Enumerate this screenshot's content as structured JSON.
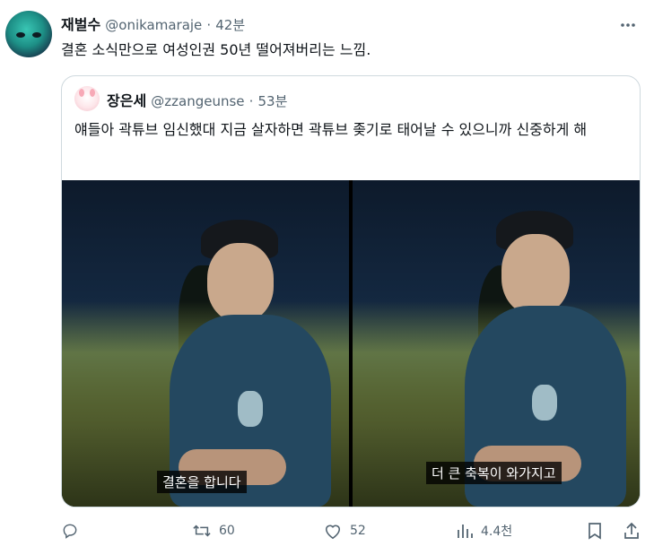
{
  "tweet": {
    "author_name": "재벌수",
    "author_handle": "@onikamaraje",
    "separator": "·",
    "time": "42분",
    "text": "결혼 소식만으로 여성인권 50년 떨어져버리는 느낌."
  },
  "quote": {
    "author_name": "장은세",
    "author_handle": "@zzangeunse",
    "separator": "·",
    "time": "53분",
    "text": "얘들아 곽튜브 임신했대 지금 살자하면 곽튜브 좆기로 태어날 수 있으니까 신중하게 해",
    "media": [
      {
        "caption": "결혼을 합니다"
      },
      {
        "caption": "더 큰 축복이 와가지고"
      }
    ]
  },
  "actions": {
    "reply_count": "",
    "retweet_count": "60",
    "like_count": "52",
    "view_count": "4.4천"
  },
  "icons": {
    "more": "more-icon",
    "reply": "reply-icon",
    "retweet": "retweet-icon",
    "like": "heart-icon",
    "views": "views-icon",
    "bookmark": "bookmark-icon",
    "share": "share-icon"
  },
  "colors": {
    "text": "#0f1419",
    "secondary": "#536471",
    "border": "#cfd9de"
  }
}
